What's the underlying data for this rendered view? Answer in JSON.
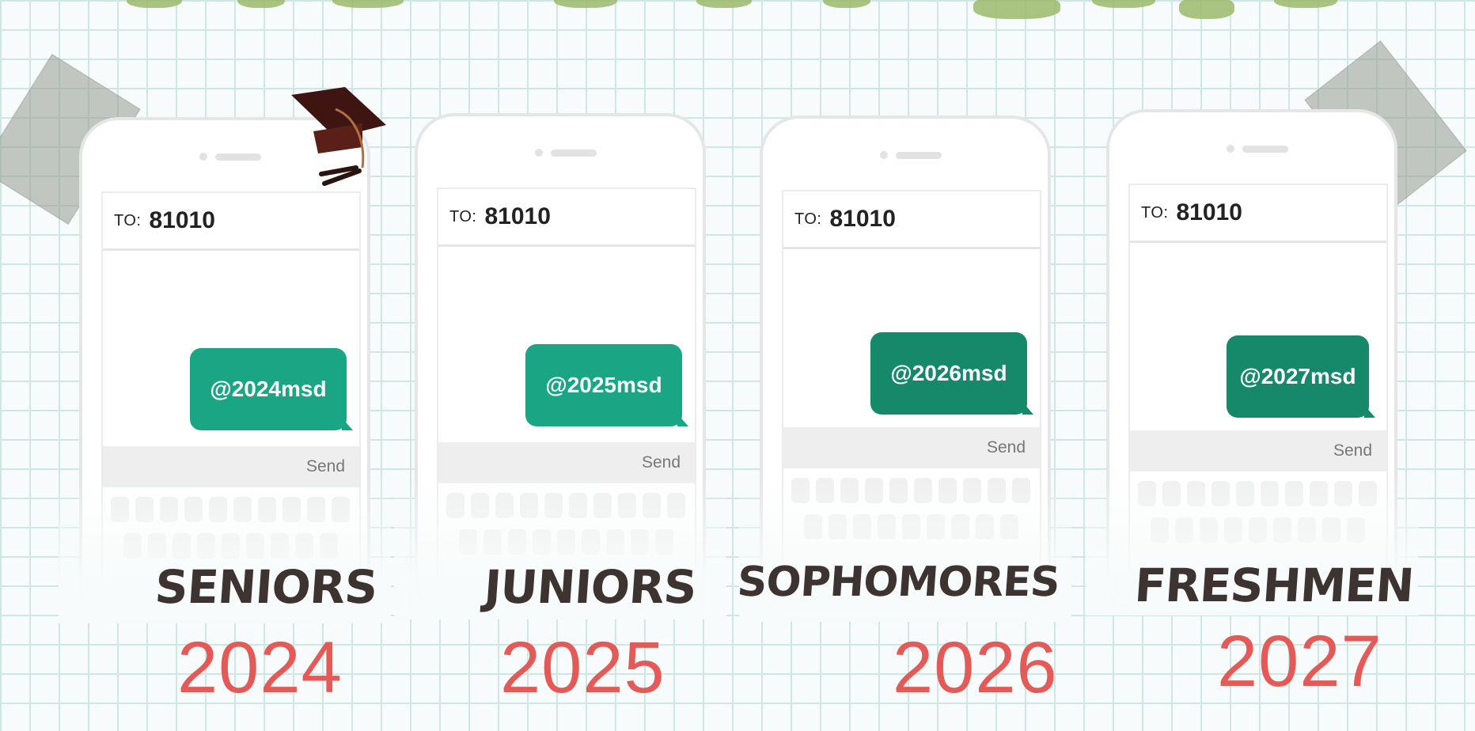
{
  "phones": [
    {
      "to_label": "TO:",
      "to_number": "81010",
      "message": "@2024msd",
      "send_label": "Send",
      "class_name": "SENIORS",
      "year": "2024"
    },
    {
      "to_label": "TO:",
      "to_number": "81010",
      "message": "@2025msd",
      "send_label": "Send",
      "class_name": "JUNIORS",
      "year": "2025"
    },
    {
      "to_label": "TO:",
      "to_number": "81010",
      "message": "@2026msd",
      "send_label": "Send",
      "class_name": "SOPHOMORES",
      "year": "2026"
    },
    {
      "to_label": "TO:",
      "to_number": "81010",
      "message": "@2027msd",
      "send_label": "Send",
      "class_name": "FRESHMEN",
      "year": "2027"
    }
  ],
  "colors": {
    "bubble": "#1aa584",
    "bubble_dark": "#16896a",
    "year": "#e55a57",
    "label": "#3d3431",
    "grid": "#cfe7e4"
  },
  "icons": {
    "cap": "graduation-cap-icon"
  }
}
